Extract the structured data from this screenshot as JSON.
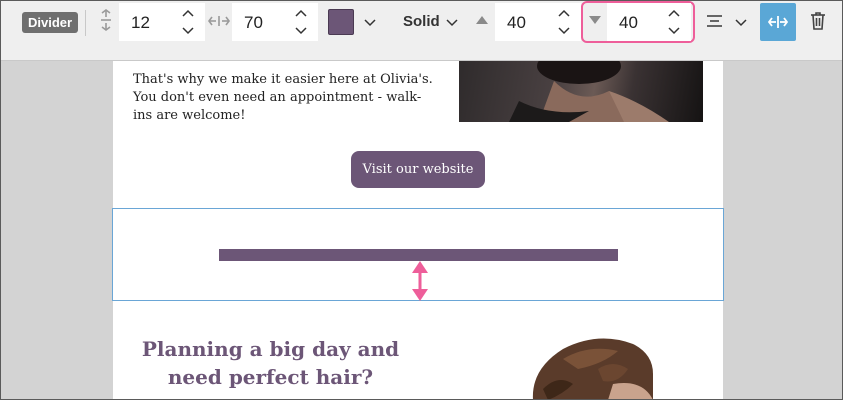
{
  "toolbar": {
    "block_type": "Divider",
    "width_value": "12",
    "length_value": "70",
    "color": "#6c5677",
    "style_value": "Solid",
    "padding_top_value": "40",
    "padding_bottom_value": "40",
    "highlight_color": "#ee5e9a",
    "accent_color": "#5aa7d6"
  },
  "email": {
    "intro_text": "That's why we make it easier here at Olivia's. You don't even need an appointment - walk-ins are welcome!",
    "cta_label": "Visit our website",
    "heading": "Planning a big day and need perfect hair?"
  }
}
